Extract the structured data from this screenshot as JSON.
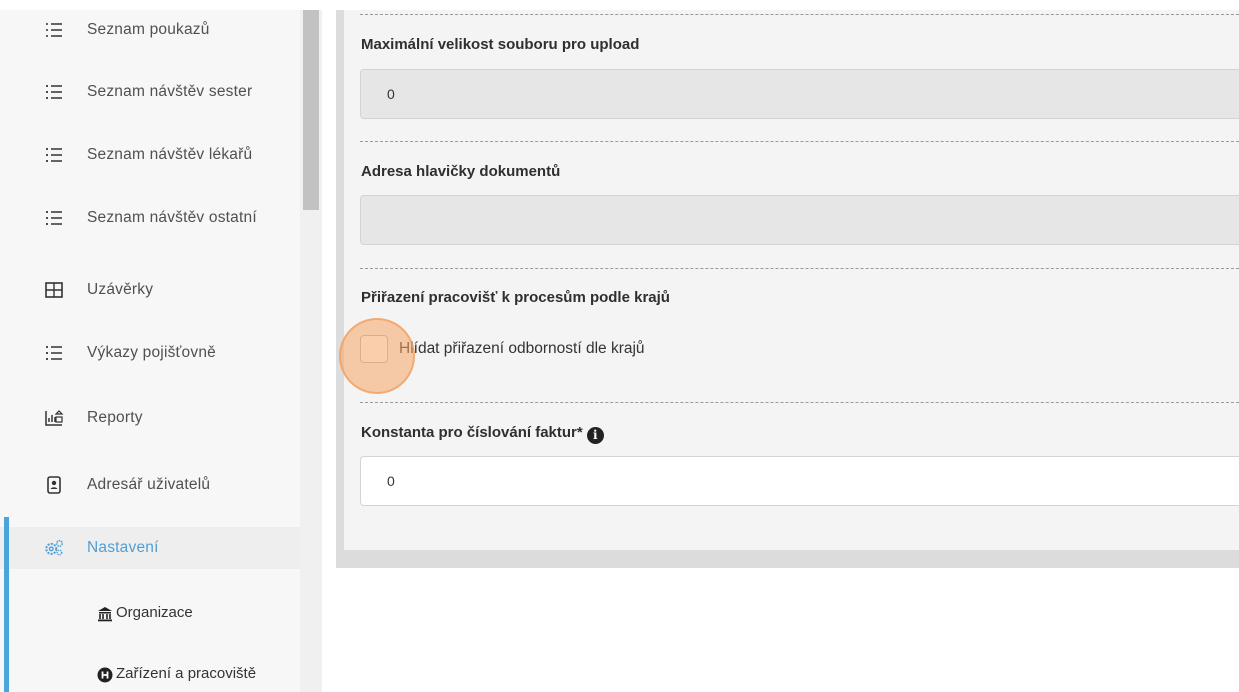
{
  "sidebar": {
    "items": [
      {
        "label": "Seznam poukazů",
        "icon": "list-ordered-icon"
      },
      {
        "label": "Seznam návštěv sester",
        "icon": "list-icon"
      },
      {
        "label": "Seznam návštěv lékařů",
        "icon": "list-icon"
      },
      {
        "label": "Seznam návštěv ostatní",
        "icon": "list-icon"
      },
      {
        "label": "Uzávěrky",
        "icon": "table-icon"
      },
      {
        "label": "Výkazy pojišťovně",
        "icon": "list-icon"
      },
      {
        "label": "Reporty",
        "icon": "report-icon"
      },
      {
        "label": "Adresář uživatelů",
        "icon": "address-book-icon"
      },
      {
        "label": "Nastavení",
        "icon": "gears-icon",
        "active": true
      }
    ],
    "subitems": [
      {
        "label": "Organizace",
        "icon": "bank-icon"
      },
      {
        "label": "Zařízení a pracoviště",
        "icon": "hospital-h-icon"
      }
    ]
  },
  "form": {
    "max_upload": {
      "label": "Maximální velikost souboru pro upload",
      "value": "0"
    },
    "header_address": {
      "label": "Adresa hlavičky dokumentů",
      "value": ""
    },
    "region_assignment": {
      "label": "Přiřazení pracovišť k procesům podle krajů",
      "checkbox_label": "Hlídat přiřazení odborností dle krajů",
      "checked": false
    },
    "invoice_constant": {
      "label": "Konstanta pro číslování faktur*",
      "value": "0"
    }
  },
  "colors": {
    "accent": "#4aa6d8",
    "click_indicator": "#f5a664"
  }
}
